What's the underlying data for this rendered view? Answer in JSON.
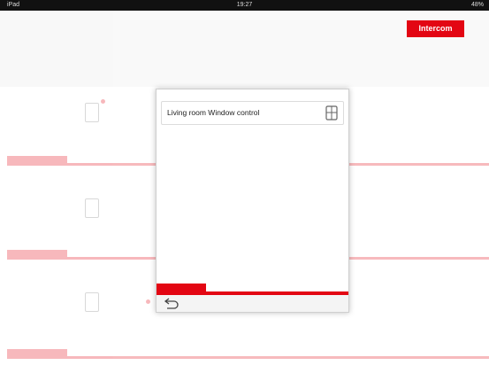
{
  "status_bar": {
    "left": "iPad",
    "time": "19:27",
    "battery": "48%"
  },
  "background": {
    "header_title": "",
    "header_subtitle": "",
    "sections": [
      {
        "label": ""
      },
      {
        "label": ""
      },
      {
        "label": ""
      }
    ],
    "items": [
      {
        "label": ""
      },
      {
        "label": ""
      },
      {
        "label": ""
      },
      {
        "label": ""
      }
    ]
  },
  "intercom_button": {
    "label": "Intercom"
  },
  "dialog": {
    "title": "Living room Window control",
    "tab_label": "",
    "icon": "window-icon",
    "back_icon": "back-arrow-icon"
  },
  "colors": {
    "accent": "#e30613",
    "status_bar": "#111111"
  }
}
